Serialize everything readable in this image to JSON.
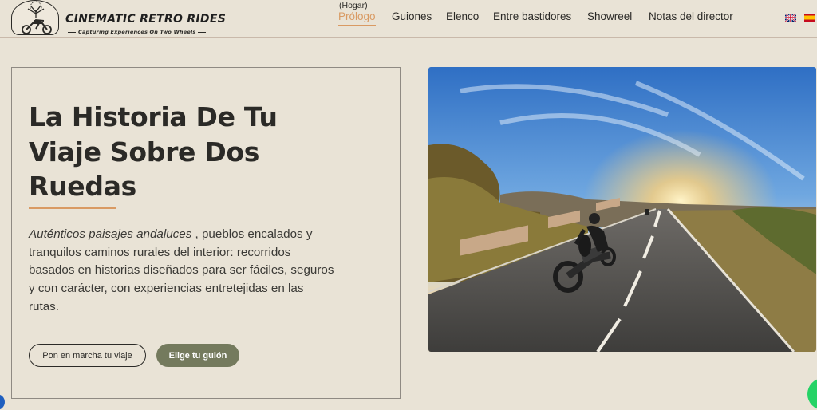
{
  "header": {
    "brand": "CINEMATIC RETRO RIDES",
    "tagline": "Capturing Experiences On Two Wheels"
  },
  "nav": {
    "active_sup": "(Hogar)",
    "active_label": "Prólogo",
    "items": [
      "Guiones",
      "Elenco",
      "Entre bastidores",
      "Showreel",
      "Notas del director"
    ]
  },
  "languages": [
    {
      "code": "en",
      "icon": "uk-flag-icon"
    },
    {
      "code": "es",
      "icon": "spain-flag-icon"
    }
  ],
  "hero": {
    "title_line1": "La Historia De Tu",
    "title_line2": "Viaje Sobre Dos",
    "title_line3": "Ruedas",
    "text_em": "Auténticos paisajes andaluces",
    "text_rest": " , pueblos encalados y tranquilos caminos rurales del interior: recorridos basados en historias diseñados para ser fáciles, seguros y con carácter, con experiencias entretejidas en las rutas.",
    "button_primary": "Pon en marcha tu viaje",
    "button_secondary": "Elige tu guión"
  },
  "colors": {
    "background": "#e9e3d6",
    "accent": "#d99a63",
    "button_green": "#747a5d",
    "text": "#2b2a27"
  }
}
